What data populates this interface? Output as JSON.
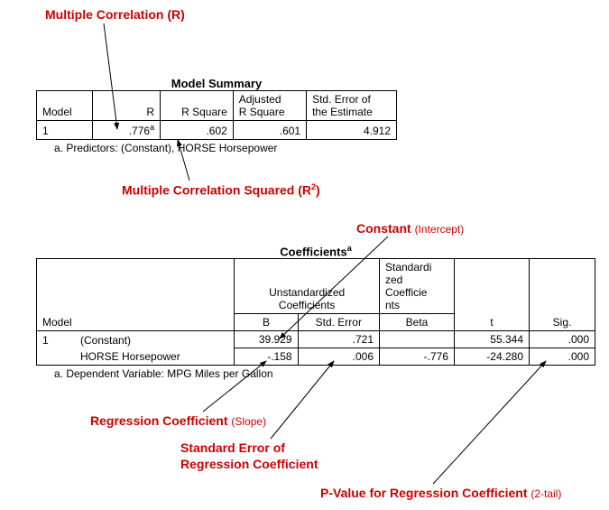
{
  "annotations": {
    "mult_r": "Multiple Correlation (R)",
    "mult_r2_pre": "Multiple Correlation Squared (R",
    "mult_r2_sup": "2",
    "mult_r2_post": ")",
    "constant": "Constant",
    "constant_sub": "(Intercept)",
    "reg_coef": "Regression Coefficient",
    "reg_coef_sub": "(Slope)",
    "se_coef_line1": "Standard Error of",
    "se_coef_line2": "Regression Coefficient",
    "pval": "P-Value for Regression Coefficient",
    "pval_sub": "(2-tail)"
  },
  "summary": {
    "title": "Model Summary",
    "headers": {
      "model": "Model",
      "r": "R",
      "rsq": "R Square",
      "adj_rsq_l1": "Adjusted",
      "adj_rsq_l2": "R Square",
      "se_l1": "Std. Error of",
      "se_l2": "the Estimate"
    },
    "row": {
      "model": "1",
      "r": ".776",
      "r_sup": "a",
      "rsq": ".602",
      "adj_rsq": ".601",
      "se": "4.912"
    },
    "footnote": "a. Predictors: (Constant), HORSE  Horsepower"
  },
  "coef": {
    "title": "Coefficients",
    "title_sup": "a",
    "headers": {
      "unstd": "Unstandardized Coefficients",
      "std_l1": "Standardi",
      "std_l2": "zed",
      "std_l3": "Coefficie",
      "std_l4": "nts",
      "model": "Model",
      "b": "B",
      "se": "Std. Error",
      "beta": "Beta",
      "t": "t",
      "sig": "Sig."
    },
    "rows": [
      {
        "model": "1",
        "label": "(Constant)",
        "b": "39.929",
        "se": ".721",
        "beta": "",
        "t": "55.344",
        "sig": ".000"
      },
      {
        "model": "",
        "label": "HORSE  Horsepower",
        "b": "-.158",
        "se": ".006",
        "beta": "-.776",
        "t": "-24.280",
        "sig": ".000"
      }
    ],
    "footnote": "a. Dependent Variable: MPG  Miles per Gallon"
  }
}
